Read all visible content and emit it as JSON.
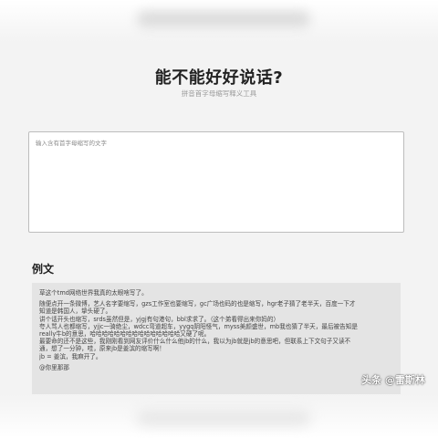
{
  "header": {
    "title": "能不能好好说话?",
    "subtitle": "拼音首字母缩写释义工具"
  },
  "input": {
    "placeholder": "输入含有首字母缩写的文字",
    "value": ""
  },
  "example": {
    "label": "例文",
    "paragraphs": [
      [
        "草这个tmd网络世界我真的太眼啥写了。"
      ],
      [
        "随便点开一条微博，艺人名字要缩写，gzs工作室也要缩写，gc广场也码的也是缩写，hgr老子猜了老半天，百度一下才",
        "知道是韩国人，挚头硬了。",
        "讲个话开头也缩写，srds虽然但是，yjgj有句港句，bbl求求了。（这个弟看得出来你妈的）",
        "夸人骂人也都缩写，yjjc一骑绝尘，wdcc弯道超车，yygq阴阳怪气，myss美颜盛世，mb我也猜了半天，最后被告知是",
        "really牛b的意思，哈哈哈哈哈哈哈哈哈哈哈哈哈哈哈又硬了呢。",
        "最要命的还不是这些，我刚刚看到网友评价什么什么他jb的什么，我以为jb就是jb的意思吧，但联系上下文句子又读不",
        "通，想了一分钟，哇，原来jb是姜滨的缩写啊！",
        "jb = 姜滨，我麻开了。"
      ],
      [
        "@你里那那"
      ]
    ]
  },
  "watermark": "头条 @雷斯林"
}
